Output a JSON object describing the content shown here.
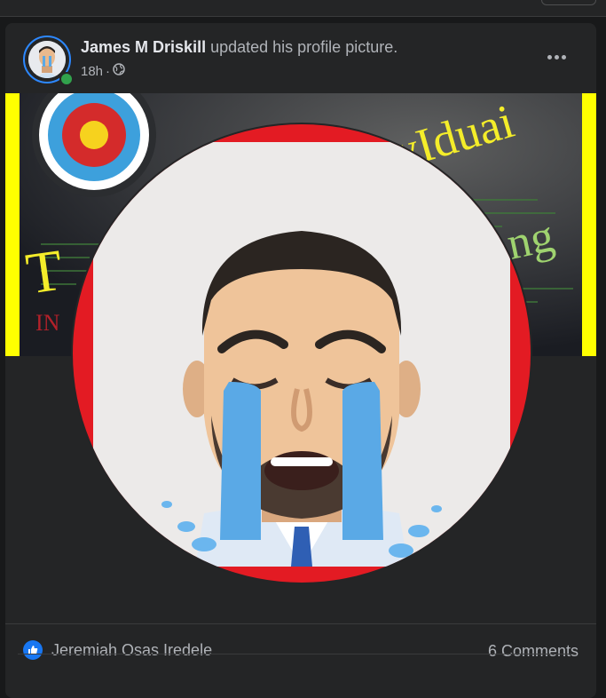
{
  "post": {
    "author": "James M Driskill",
    "action": "updated his profile picture.",
    "time": "18h",
    "separator": "·",
    "privacy_icon": "globe-icon",
    "more_icon": "more-options-icon"
  },
  "cover": {
    "text_top": "vIduai",
    "text_left": "T",
    "text_right": "ng",
    "text_red": "IN"
  },
  "footer": {
    "reaction_icon": "like-icon",
    "reactor_name": "Jeremiah Osas Iredele",
    "comments": "6 Comments"
  },
  "colors": {
    "background": "#18191a",
    "card": "#242526",
    "accent": "#2d88ff",
    "online": "#31a24c",
    "like": "#1877f2",
    "cover_border": "#ffff00",
    "profile_border": "#e31b23",
    "tears": "#5aa9e6"
  }
}
